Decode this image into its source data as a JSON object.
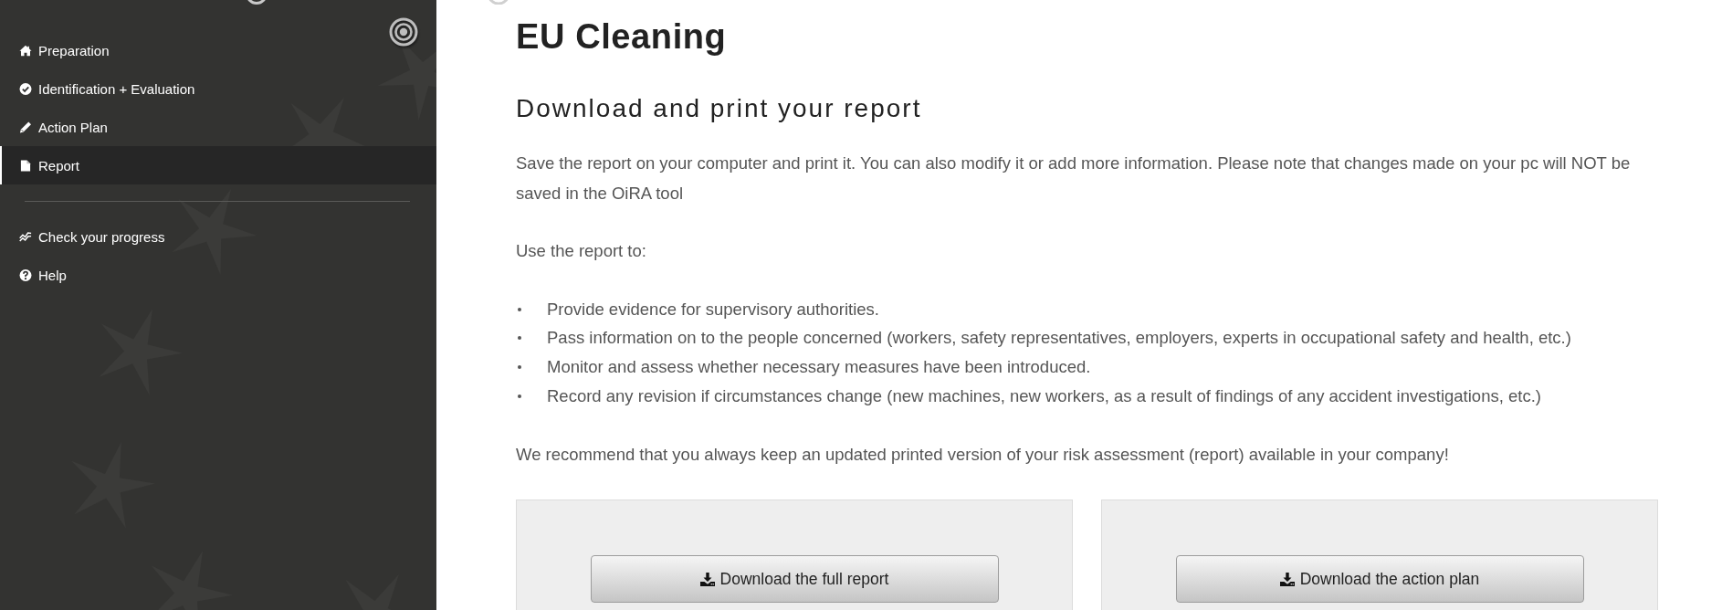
{
  "sidebar": {
    "sections": [
      {
        "items": [
          {
            "label": "Preparation",
            "selected": false
          },
          {
            "label": "Identification + Evaluation",
            "selected": false
          },
          {
            "label": "Action Plan",
            "selected": false
          },
          {
            "label": "Report",
            "selected": true
          }
        ]
      },
      {
        "items": [
          {
            "label": "Check your progress",
            "selected": false
          },
          {
            "label": "Help",
            "selected": false
          }
        ]
      }
    ]
  },
  "main": {
    "title": "EU Cleaning",
    "subtitle": "Download and print your report",
    "intro": "Save the report on your computer and print it. You can also modify it or add more information. Please note that changes made on your pc will NOT be saved in the OiRA tool",
    "list_intro": "Use the report to:",
    "bullets": [
      "Provide evidence for supervisory authorities.",
      "Pass information on to the people concerned (workers, safety representatives, employers, experts in occupational safety and health, etc.)",
      "Monitor and assess whether necessary measures have been introduced.",
      "Record any revision if circumstances change (new machines, new workers, as a result of findings of any accident investigations, etc.)"
    ],
    "recommendation": "We recommend that you always keep an updated printed version of your risk assessment (report) available in your company!",
    "downloads": [
      {
        "label": "Download the full report"
      },
      {
        "label": "Download the action plan"
      }
    ]
  }
}
